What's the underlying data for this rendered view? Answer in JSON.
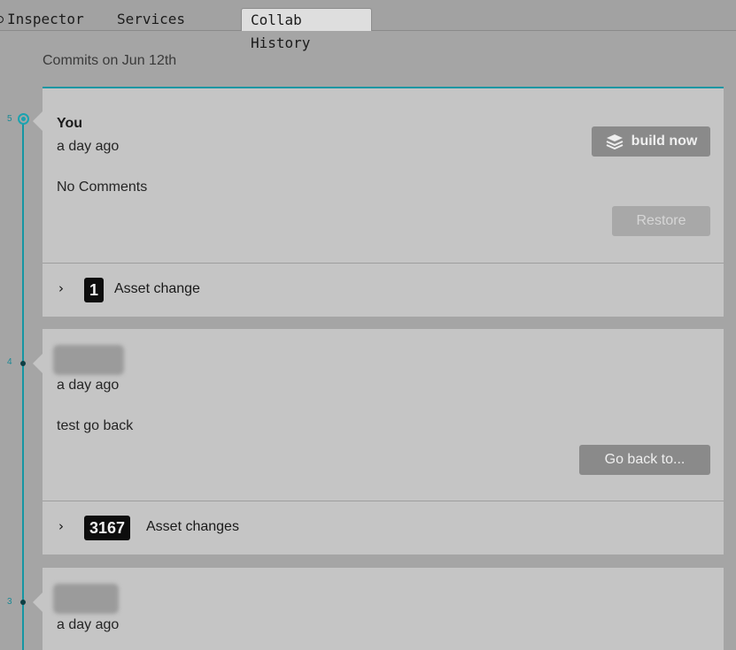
{
  "tabs": {
    "inspector": "Inspector",
    "services": "Services",
    "collab_history": "Collab History"
  },
  "history": {
    "date_header": "Commits on Jun 12th",
    "commits": [
      {
        "revision": "5",
        "author": "You",
        "time": "a day ago",
        "comment": "No Comments",
        "build_button": "build now",
        "action_button": "Restore",
        "change_count": "1",
        "change_label": "Asset change"
      },
      {
        "revision": "4",
        "author": "",
        "time": "a day ago",
        "comment": "test go back",
        "action_button": "Go back to...",
        "change_count": "3167",
        "change_label": "Asset changes"
      },
      {
        "revision": "3",
        "author": "",
        "time": "a day ago"
      }
    ]
  },
  "colors": {
    "accent": "#1596a3",
    "background": "#a5a5a5",
    "card": "#c5c5c5",
    "badge": "#0d0d0d"
  },
  "icons": [
    "inspector-icon",
    "layers-icon",
    "chevron-right-icon"
  ]
}
